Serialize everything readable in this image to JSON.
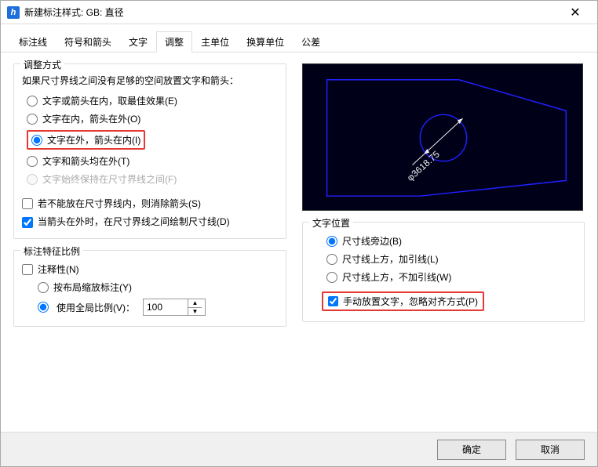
{
  "window": {
    "title": "新建标注样式: GB: 直径"
  },
  "tabs": [
    "标注线",
    "符号和箭头",
    "文字",
    "调整",
    "主单位",
    "换算单位",
    "公差"
  ],
  "active_tab_index": 3,
  "fit": {
    "group_title": "调整方式",
    "intro": "如果尺寸界线之间没有足够的空间放置文字和箭头：",
    "options": [
      "文字或箭头在内，取最佳效果(E)",
      "文字在内，箭头在外(O)",
      "文字在外，箭头在内(I)",
      "文字和箭头均在外(T)",
      "文字始终保持在尺寸界线之间(F)"
    ],
    "selected": 2,
    "suppress_arrows": "若不能放在尺寸界线内，则消除箭头(S)",
    "draw_dimline": "当箭头在外时，在尺寸界线之间绘制尺寸线(D)"
  },
  "scale": {
    "group_title": "标注特征比例",
    "annotative": "注释性(N)",
    "layout_scale": "按布局缩放标注(Y)",
    "overall_scale": "使用全局比例(V)：",
    "value": "100"
  },
  "textpos": {
    "group_title": "文字位置",
    "options": [
      "尺寸线旁边(B)",
      "尺寸线上方，加引线(L)",
      "尺寸线上方，不加引线(W)"
    ],
    "selected": 0,
    "manual": "手动放置文字，忽略对齐方式(P)"
  },
  "preview": {
    "dim_label": "φ3618.75"
  },
  "footer": {
    "ok": "确定",
    "cancel": "取消"
  }
}
